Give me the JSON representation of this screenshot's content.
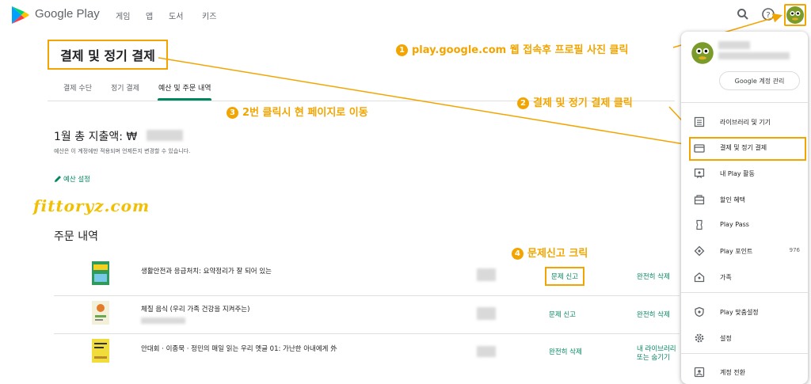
{
  "brand": {
    "name": "Google Play"
  },
  "nav": [
    "게임",
    "앱",
    "도서",
    "키즈"
  ],
  "header_icons": [
    "search-icon",
    "help-icon",
    "avatar"
  ],
  "page": {
    "title": "결제 및 정기 결제",
    "tabs": [
      "결제 수단",
      "정기 결제",
      "예산 및 주문 내역"
    ],
    "active_tab": "예산 및 주문 내역",
    "monthly_spend_label": "1월 총 지출액: ₩",
    "budget_note": "예산은 이 계정에만 적용되며 언제든지 변경할 수 있습니다.",
    "budget_link": "예산 설정",
    "orders_title": "주문 내역"
  },
  "orders": [
    {
      "title": "생활안전과 응급처치: 요약정리가 잘 되어 있는",
      "action1": "문제 신고",
      "action2": "완전히 삭제",
      "action2_line2": ""
    },
    {
      "title": "체질 음식 (우리 가족 건강을 지켜주는)",
      "action1": "문제 신고",
      "action2": "완전히 삭제",
      "action2_line2": ""
    },
    {
      "title": "안대회 · 이종묵 · 정민의 매일 읽는 우리 옛글 01: 가난한 아내에게 外",
      "action1": "완전히 삭제",
      "action2": "내 라이브러리",
      "action2_line2": "또는 숨기기"
    }
  ],
  "menu": {
    "manage_account": "Google 계정 관리",
    "items": [
      {
        "label": "라이브러리 및 기기",
        "icon": "library-icon",
        "count": ""
      },
      {
        "label": "결제 및 정기 결제",
        "icon": "card-icon",
        "count": ""
      },
      {
        "label": "내 Play 활동",
        "icon": "activity-icon",
        "count": ""
      },
      {
        "label": "할인 혜택",
        "icon": "offers-icon",
        "count": ""
      },
      {
        "label": "Play Pass",
        "icon": "ticket-icon",
        "count": ""
      },
      {
        "label": "Play 포인트",
        "icon": "points-icon",
        "count": "976"
      },
      {
        "label": "가족",
        "icon": "family-icon",
        "count": ""
      },
      {
        "label": "Play 맞춤설정",
        "icon": "shield-icon",
        "count": ""
      },
      {
        "label": "설정",
        "icon": "gear-icon",
        "count": ""
      },
      {
        "label": "계정 전환",
        "icon": "switch-account-icon",
        "count": ""
      }
    ]
  },
  "annotations": {
    "a1": {
      "num": "1",
      "text": "play.google.com 웹 접속후 프로필 사진 클릭"
    },
    "a2": {
      "num": "2",
      "text": "결제 및 정기 결제 클릭"
    },
    "a3": {
      "num": "3",
      "text": "2번 클릭시 현 페이지로 이동"
    },
    "a4": {
      "num": "4",
      "text": "문제신고 크릭"
    }
  },
  "watermark": "fittoryz.com",
  "colors": {
    "accent": "#01875f",
    "highlight": "#f2a500",
    "text": "#202124",
    "muted": "#5f6368"
  }
}
